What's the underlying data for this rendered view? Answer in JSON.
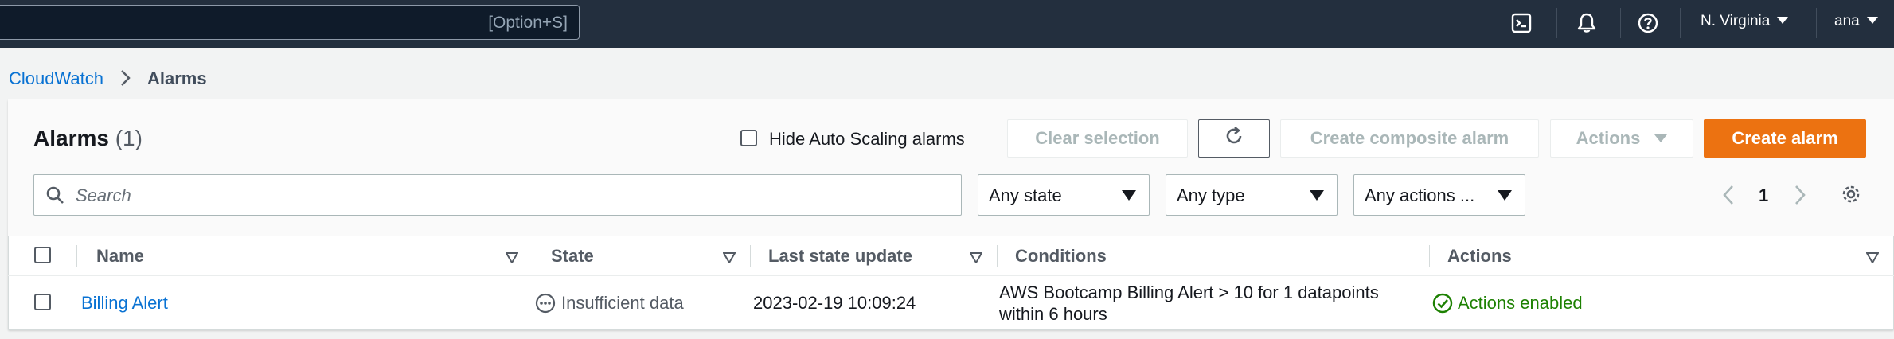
{
  "topnav": {
    "search_shortcut": "[Option+S]",
    "region": "N. Virginia",
    "user": "ana",
    "icons": [
      "cloudshell-icon",
      "bell-icon",
      "help-icon"
    ]
  },
  "breadcrumb": {
    "parent": "CloudWatch",
    "current": "Alarms"
  },
  "alarms": {
    "title": "Alarms",
    "count": "(1)",
    "hide_autoscaling_label": "Hide Auto Scaling alarms",
    "buttons": {
      "clear_selection": "Clear selection",
      "create_composite": "Create composite alarm",
      "actions": "Actions",
      "create_alarm": "Create alarm"
    },
    "search_placeholder": "Search",
    "filters": {
      "state": "Any state",
      "type": "Any type",
      "actions": "Any actions ..."
    },
    "page": "1",
    "columns": [
      "Name",
      "State",
      "Last state update",
      "Conditions",
      "Actions"
    ],
    "rows": [
      {
        "name": "Billing Alert",
        "state": "Insufficient data",
        "last_update": "2023-02-19 10:09:24",
        "condition_line1": "AWS Bootcamp Billing Alert > 10 for 1 datapoints",
        "condition_line2": "within 6 hours",
        "actions": "Actions enabled"
      }
    ]
  },
  "colors": {
    "nav_bg": "#232f3e",
    "link": "#0972d3",
    "primary": "#ec7211",
    "success": "#1d8102"
  }
}
